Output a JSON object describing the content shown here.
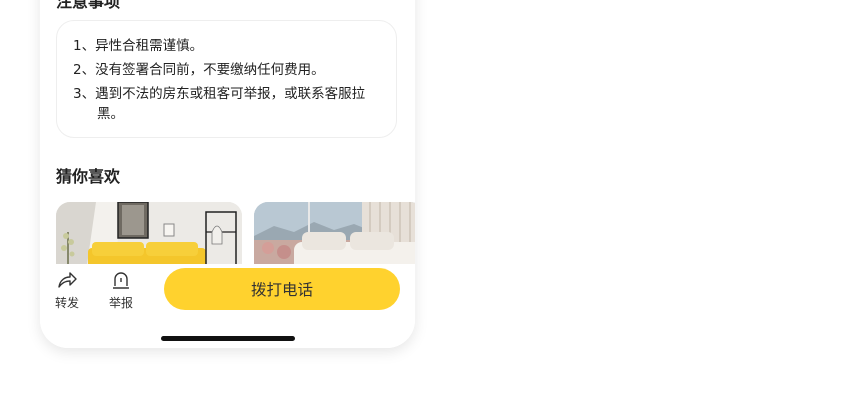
{
  "section_title": "注意事项",
  "notices": [
    {
      "num": "1、",
      "text": "异性合租需谨慎。"
    },
    {
      "num": "2、",
      "text": "没有签署合同前，不要缴纳任何费用。"
    },
    {
      "num": "3、",
      "text": "遇到不法的房东或租客可举报，或联系客服拉黑。"
    }
  ],
  "guess_title": "猜你喜欢",
  "recommendations": [
    {
      "name": "yellow-sofa-living-room"
    },
    {
      "name": "white-sofa-window-view"
    }
  ],
  "bottom_bar": {
    "forward_label": "转发",
    "report_label": "举报",
    "call_label": "拨打电话"
  },
  "colors": {
    "accent": "#ffd22e",
    "text": "#222222",
    "card_border": "#eeeeee",
    "home_indicator": "#111111"
  },
  "icons": {
    "forward": "share-arrow-icon",
    "report": "alarm-light-icon"
  }
}
